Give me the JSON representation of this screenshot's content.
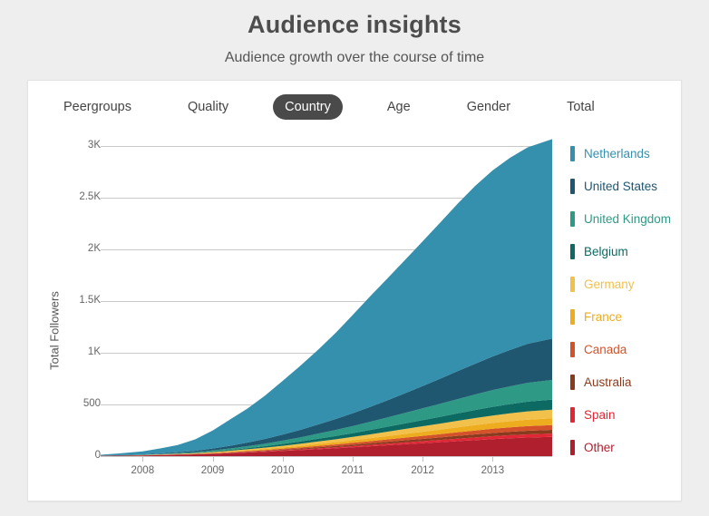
{
  "header": {
    "title": "Audience insights",
    "subtitle": "Audience growth over the course of time"
  },
  "tabs": [
    {
      "label": "Peergroups",
      "active": false
    },
    {
      "label": "Quality",
      "active": false
    },
    {
      "label": "Country",
      "active": true
    },
    {
      "label": "Age",
      "active": false
    },
    {
      "label": "Gender",
      "active": false
    },
    {
      "label": "Total",
      "active": false
    }
  ],
  "colors": {
    "active_tab_bg": "#4a4a4a",
    "active_tab_text": "#ffffff",
    "card_bg": "#ffffff",
    "page_bg": "#eeeeee",
    "gridline": "#c9c9c9",
    "axis_text": "#666666",
    "title_text": "#4d4d4d"
  },
  "chart_data": {
    "type": "area",
    "stacked": true,
    "title": "Audience insights",
    "subtitle": "Audience growth over the course of time",
    "xlabel": "",
    "ylabel": "Total Followers",
    "grid": true,
    "legend_position": "right",
    "xlim": [
      2007.4,
      2013.85
    ],
    "ylim": [
      0,
      3000
    ],
    "ytick_labels": [
      "0",
      "500",
      "1K",
      "1.5K",
      "2K",
      "2.5K",
      "3K"
    ],
    "ytick_values": [
      0,
      500,
      1000,
      1500,
      2000,
      2500,
      3000
    ],
    "xtick_labels": [
      "2008",
      "2009",
      "2010",
      "2011",
      "2012",
      "2013"
    ],
    "xtick_values": [
      2008,
      2009,
      2010,
      2011,
      2012,
      2013
    ],
    "x": [
      2007.4,
      2007.7,
      2008.0,
      2008.25,
      2008.5,
      2008.75,
      2009.0,
      2009.25,
      2009.5,
      2009.75,
      2010.0,
      2010.25,
      2010.5,
      2010.75,
      2011.0,
      2011.25,
      2011.5,
      2011.75,
      2012.0,
      2012.25,
      2012.5,
      2012.75,
      2013.0,
      2013.25,
      2013.5,
      2013.85
    ],
    "series": [
      {
        "name": "Netherlands",
        "color": "#3590ad",
        "values": [
          8,
          18,
          30,
          48,
          70,
          110,
          175,
          255,
          330,
          420,
          520,
          620,
          720,
          830,
          950,
          1070,
          1180,
          1290,
          1400,
          1510,
          1620,
          1720,
          1800,
          1860,
          1900,
          1930
        ]
      },
      {
        "name": "United States",
        "color": "#1f5670",
        "values": [
          1,
          2,
          3,
          5,
          8,
          12,
          18,
          26,
          35,
          46,
          58,
          72,
          88,
          105,
          124,
          144,
          166,
          190,
          215,
          242,
          270,
          298,
          325,
          352,
          378,
          400
        ]
      },
      {
        "name": "United Kingdom",
        "color": "#2e9a86",
        "values": [
          1,
          1,
          2,
          3,
          5,
          7,
          10,
          14,
          19,
          25,
          32,
          40,
          49,
          58,
          68,
          79,
          90,
          102,
          114,
          126,
          138,
          150,
          162,
          172,
          182,
          190
        ]
      },
      {
        "name": "Belgium",
        "color": "#0d6a62",
        "values": [
          0,
          1,
          1,
          2,
          3,
          4,
          6,
          8,
          11,
          14,
          18,
          22,
          27,
          32,
          37,
          42,
          48,
          54,
          60,
          66,
          72,
          78,
          84,
          89,
          94,
          98
        ]
      },
      {
        "name": "Germany",
        "color": "#f2c14b",
        "values": [
          0,
          1,
          1,
          2,
          3,
          4,
          6,
          8,
          10,
          13,
          16,
          20,
          24,
          28,
          33,
          38,
          43,
          48,
          53,
          58,
          63,
          68,
          72,
          76,
          80,
          83
        ]
      },
      {
        "name": "France",
        "color": "#edad1e",
        "values": [
          0,
          0,
          1,
          1,
          2,
          3,
          4,
          6,
          8,
          10,
          12,
          15,
          18,
          21,
          24,
          28,
          32,
          36,
          40,
          44,
          48,
          52,
          56,
          59,
          62,
          65
        ]
      },
      {
        "name": "Canada",
        "color": "#d4522a",
        "values": [
          0,
          0,
          1,
          1,
          2,
          2,
          3,
          4,
          6,
          7,
          9,
          11,
          13,
          15,
          18,
          20,
          23,
          26,
          29,
          32,
          35,
          38,
          41,
          43,
          45,
          47
        ]
      },
      {
        "name": "Australia",
        "color": "#8a3b1e",
        "values": [
          0,
          0,
          0,
          1,
          1,
          2,
          2,
          3,
          4,
          5,
          7,
          8,
          10,
          12,
          14,
          16,
          18,
          20,
          22,
          24,
          27,
          29,
          31,
          33,
          35,
          36
        ]
      },
      {
        "name": "Spain",
        "color": "#e32636",
        "values": [
          0,
          0,
          0,
          1,
          1,
          1,
          2,
          3,
          4,
          5,
          6,
          7,
          9,
          10,
          12,
          14,
          16,
          18,
          20,
          22,
          24,
          26,
          28,
          30,
          31,
          32
        ]
      },
      {
        "name": "Other",
        "color": "#b01f2e",
        "values": [
          3,
          5,
          7,
          10,
          13,
          17,
          22,
          28,
          35,
          42,
          50,
          58,
          67,
          76,
          85,
          95,
          105,
          115,
          125,
          135,
          145,
          155,
          165,
          173,
          180,
          186
        ]
      }
    ]
  }
}
